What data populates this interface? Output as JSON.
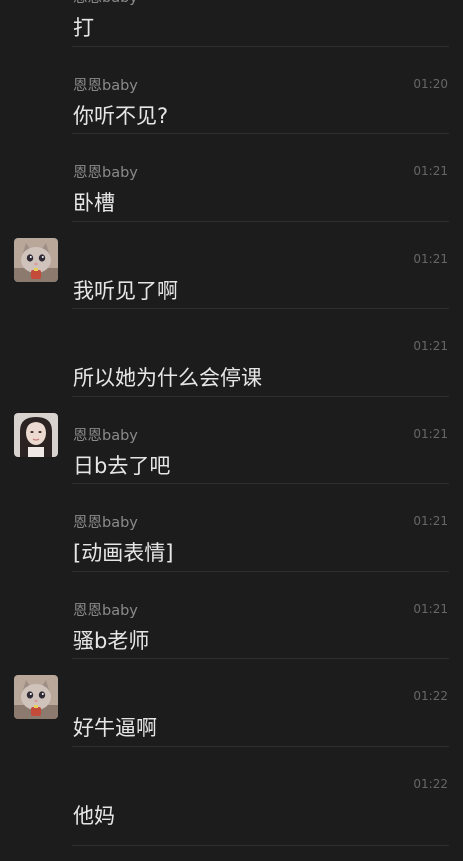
{
  "colors": {
    "background": "#1c1c1c",
    "divider": "#2f2f2f",
    "sender": "#8a8a8a",
    "time": "#666666",
    "text": "#e6e6e6"
  },
  "messages": [
    {
      "sender": "恩恩baby",
      "time": "",
      "text": "打",
      "avatar": ""
    },
    {
      "sender": "恩恩baby",
      "time": "01:20",
      "text": "你听不见?",
      "avatar": ""
    },
    {
      "sender": "恩恩baby",
      "time": "01:21",
      "text": "卧槽",
      "avatar": ""
    },
    {
      "sender": "",
      "time": "01:21",
      "text": "我听见了啊",
      "avatar": "cat-avatar"
    },
    {
      "sender": "",
      "time": "01:21",
      "text": "所以她为什么会停课",
      "avatar": ""
    },
    {
      "sender": "恩恩baby",
      "time": "01:21",
      "text": "日b去了吧",
      "avatar": "girl-avatar"
    },
    {
      "sender": "恩恩baby",
      "time": "01:21",
      "text": "[动画表情]",
      "avatar": ""
    },
    {
      "sender": "恩恩baby",
      "time": "01:21",
      "text": "骚b老师",
      "avatar": ""
    },
    {
      "sender": "",
      "time": "01:22",
      "text": "好牛逼啊",
      "avatar": "cat-avatar"
    },
    {
      "sender": "",
      "time": "01:22",
      "text": "他妈",
      "avatar": ""
    }
  ]
}
